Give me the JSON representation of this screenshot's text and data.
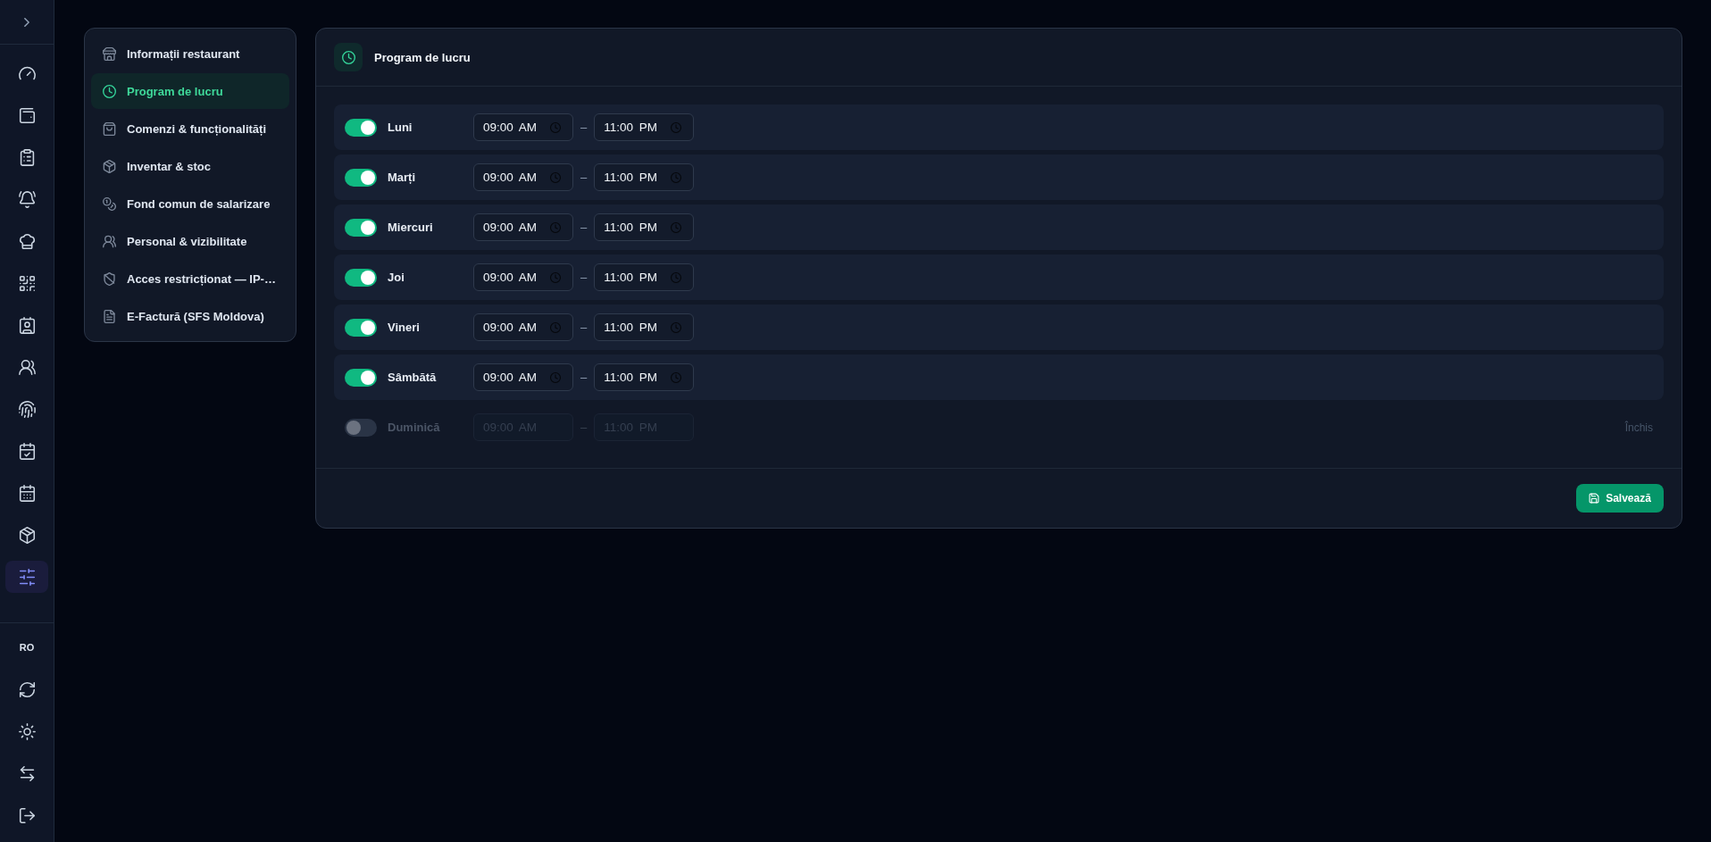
{
  "rail": {
    "items": [
      {
        "selected": false
      },
      {
        "selected": false
      },
      {
        "selected": false
      },
      {
        "selected": false
      },
      {
        "selected": false
      },
      {
        "selected": false
      },
      {
        "selected": false
      },
      {
        "selected": false
      },
      {
        "selected": false
      },
      {
        "selected": false
      },
      {
        "selected": false
      },
      {
        "selected": false
      },
      {
        "selected": true
      }
    ],
    "language": "RO"
  },
  "settings_nav": {
    "items": [
      {
        "label": "Informații restaurant",
        "selected": false
      },
      {
        "label": "Program de lucru",
        "selected": true
      },
      {
        "label": "Comenzi & funcționalități",
        "selected": false
      },
      {
        "label": "Inventar & stoc",
        "selected": false
      },
      {
        "label": "Fond comun de salarizare",
        "selected": false
      },
      {
        "label": "Personal & vizibilitate",
        "selected": false
      },
      {
        "label": "Acces restricționat — IP-…",
        "selected": false
      },
      {
        "label": "E-Factură (SFS Moldova)",
        "selected": false
      }
    ]
  },
  "schedule": {
    "title": "Program de lucru",
    "days": [
      {
        "name": "Luni",
        "enabled": true,
        "open": "09:00 AM",
        "separator": "–",
        "close": "11:00 PM"
      },
      {
        "name": "Marți",
        "enabled": true,
        "open": "09:00 AM",
        "separator": "–",
        "close": "11:00 PM"
      },
      {
        "name": "Miercuri",
        "enabled": true,
        "open": "09:00 AM",
        "separator": "–",
        "close": "11:00 PM"
      },
      {
        "name": "Joi",
        "enabled": true,
        "open": "09:00 AM",
        "separator": "–",
        "close": "11:00 PM"
      },
      {
        "name": "Vineri",
        "enabled": true,
        "open": "09:00 AM",
        "separator": "–",
        "close": "11:00 PM"
      },
      {
        "name": "Sâmbătă",
        "enabled": true,
        "open": "09:00 AM",
        "separator": "–",
        "close": "11:00 PM"
      },
      {
        "name": "Duminică",
        "enabled": false,
        "open": "09:00 AM",
        "separator": "–",
        "close": "11:00 PM",
        "status": "Închis"
      }
    ],
    "save_button": "Salvează"
  }
}
